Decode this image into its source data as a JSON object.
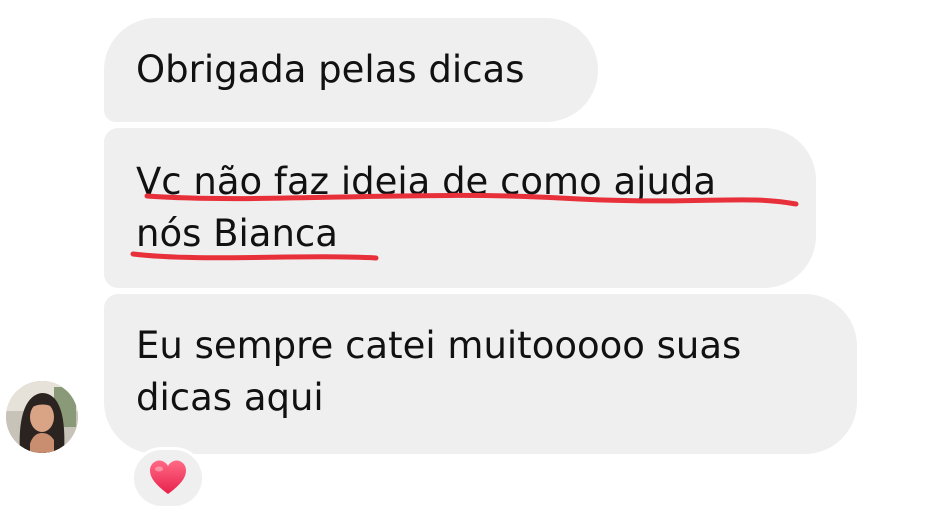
{
  "messages": [
    {
      "lines": [
        "Obrigada pelas dicas"
      ]
    },
    {
      "lines": [
        "Vc não faz ideia de como ajuda",
        "nós Bianca"
      ]
    },
    {
      "lines": [
        "Eu sempre catei muitooooo suas",
        "dicas aqui"
      ]
    }
  ],
  "colors": {
    "bubble": "#efefef",
    "text": "#111111",
    "underline_annotation": "#e8303a",
    "heart": "#f0395a"
  },
  "avatar": {
    "icon": "profile-photo-avatar"
  },
  "reaction": {
    "icon": "heart-icon"
  }
}
